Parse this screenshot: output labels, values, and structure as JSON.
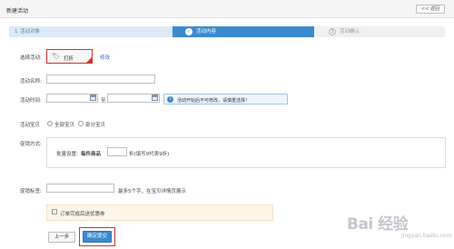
{
  "header": {
    "title": "新建活动",
    "back_label": "<< 返回"
  },
  "steps": [
    {
      "num": "1",
      "label": "活动对象"
    },
    {
      "num": "2",
      "label": "活动内容"
    },
    {
      "num": "3",
      "label": "活动确认"
    }
  ],
  "form": {
    "select_activity": {
      "label": "选择活动:",
      "tag": "打折",
      "modify_link": "修改"
    },
    "activity_name": {
      "label": "活动名称:",
      "value": ""
    },
    "activity_time": {
      "label": "活动时间:",
      "start": "",
      "separator": "至",
      "end": "",
      "tip": "活动开始后不可修改，请慎重选择！"
    },
    "activity_goods": {
      "label": "活动宝贝",
      "options": [
        "全部宝贝",
        "部分宝贝"
      ]
    },
    "discount": {
      "label": "促销方式:",
      "batch_label": "批量设置:",
      "per_item": "每件商品",
      "value": "",
      "suffix": "折(填写9代表9折)"
    },
    "promo_tag": {
      "label": "促销标签:",
      "value": "",
      "hint": "最多5个字，在宝贝详情页展示"
    },
    "note": {
      "checkbox_label": "订单完成后送优惠券"
    }
  },
  "buttons": {
    "prev": "上一步",
    "submit": "确定提交"
  },
  "watermark": {
    "main": "Bai 经验",
    "sub": "jingyan.baidu.com"
  },
  "colors": {
    "accent": "#3b8ad0",
    "highlight": "#c8372e",
    "tip_bg": "#edf5fc"
  }
}
